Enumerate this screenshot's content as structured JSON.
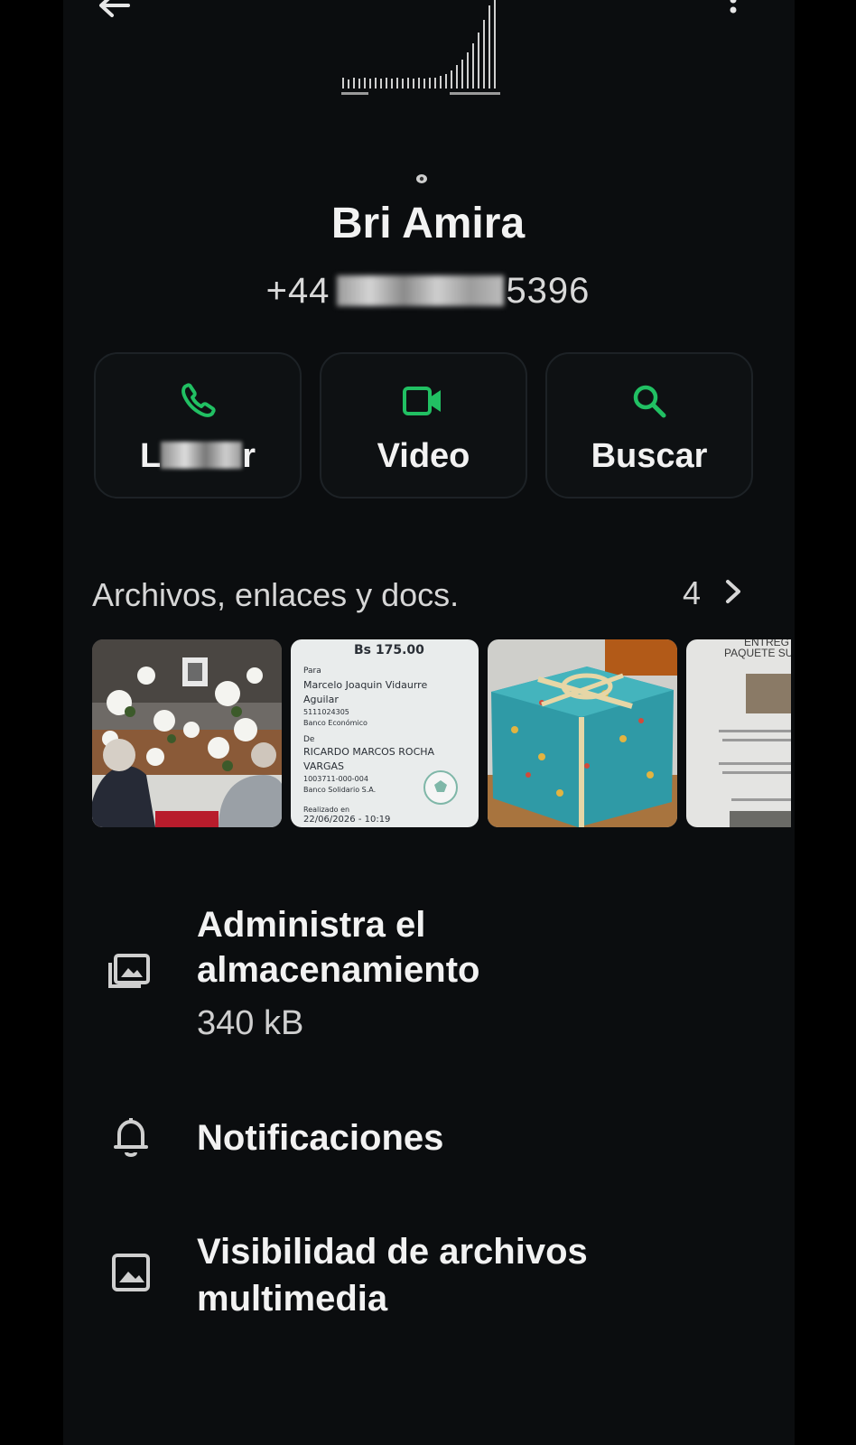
{
  "contact": {
    "name": "Bri Amira",
    "phone_prefix": "+44",
    "phone_suffix": "5396"
  },
  "actions": [
    {
      "label_start": "L",
      "label_end": "r",
      "icon": "phone-icon"
    },
    {
      "label": "Video",
      "icon": "video-icon"
    },
    {
      "label": "Buscar",
      "icon": "search-icon"
    }
  ],
  "media": {
    "title": "Archivos, enlaces y docs.",
    "count": "4",
    "receipt": {
      "amount": "Bs 175.00",
      "to_label": "Para",
      "to_name_1": "Marcelo Joaquin Vidaurre",
      "to_name_2": "Aguilar",
      "to_account": "5111024305",
      "to_bank": "Banco Económico",
      "from_label": "De",
      "from_name_1": "RICARDO MARCOS ROCHA",
      "from_name_2": "VARGAS",
      "from_account": "1003711-000-004",
      "from_bank": "Banco Solidario S.A.",
      "done_label": "Realizado en",
      "done_date": "22/06/2026 - 10:19"
    },
    "delivery": {
      "line1": "ENTREG",
      "line2": "PAQUETE SU"
    }
  },
  "menu": {
    "storage_title_1": "Administra el",
    "storage_title_2": "almacenamiento",
    "storage_size": "340 kB",
    "notifications": "Notificaciones",
    "visibility_1": "Visibilidad de archivos",
    "visibility_2": "multimedia"
  },
  "colors": {
    "accent": "#21c063",
    "background": "#0b0d0f"
  }
}
